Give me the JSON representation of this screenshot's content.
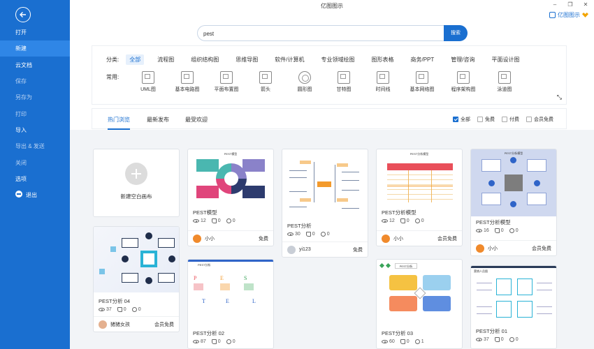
{
  "app": {
    "title": "亿图图示",
    "account_label": "亿图图示"
  },
  "sidebar": {
    "items": [
      {
        "label": "打开"
      },
      {
        "label": "新建"
      },
      {
        "label": "云文档"
      },
      {
        "label": "保存"
      },
      {
        "label": "另存为"
      },
      {
        "label": "打印"
      },
      {
        "label": "导入"
      },
      {
        "label": "导出 & 发送"
      },
      {
        "label": "关闭"
      },
      {
        "label": "选项"
      },
      {
        "label": "退出"
      }
    ]
  },
  "search": {
    "value": "pest",
    "button_label": "搜索"
  },
  "categories": {
    "label": "分类:",
    "items": [
      "全部",
      "流程图",
      "组织结构图",
      "思维导图",
      "软件/计算机",
      "专业领域绘图",
      "图形表格",
      "商务/PPT",
      "管理/咨询",
      "平面设计图"
    ],
    "common_label": "常用:",
    "common_items": [
      "UML图",
      "基本电路图",
      "平面布置图",
      "箭头",
      "圆形图",
      "甘特图",
      "时间线",
      "基本网络图",
      "程序架构图",
      "泳道图"
    ]
  },
  "tabs": {
    "items": [
      "热门浏览",
      "最新发布",
      "最受欢迎"
    ],
    "filters": [
      "全部",
      "免费",
      "付费",
      "会员免费"
    ]
  },
  "new_blank": {
    "label": "新建空白画布"
  },
  "cards": [
    {
      "title": "PEST模型",
      "views": "12",
      "likes": "0",
      "comments": "0",
      "author": "小小",
      "price": "免费",
      "thumb_title": "PEST模型"
    },
    {
      "title": "PEST分析",
      "views": "30",
      "likes": "0",
      "comments": "0",
      "author": "yi123",
      "price": "免费"
    },
    {
      "title": "PEST分析模型",
      "views": "12",
      "likes": "0",
      "comments": "0",
      "author": "小小",
      "price": "会员免费",
      "thumb_title": "PEST分析模型"
    },
    {
      "title": "PEST分析模型",
      "views": "16",
      "likes": "0",
      "comments": "0",
      "author": "小小",
      "price": "会员免费",
      "thumb_title": "PEST分析模型"
    },
    {
      "title": "PEST分析 04",
      "views": "37",
      "likes": "0",
      "comments": "0",
      "author": "猪猪女孩",
      "price": "会员免费"
    },
    {
      "title": "PEST分析 02",
      "views": "87",
      "likes": "0",
      "comments": "0",
      "thumb_title": "PEST分析"
    },
    {
      "title": "PEST分析 03",
      "views": "60",
      "likes": "0",
      "comments": "1",
      "thumb_title": "PEST分析"
    },
    {
      "title": "PEST分析 01",
      "views": "37",
      "likes": "0",
      "comments": "0",
      "thumb_title": "营销人员图"
    }
  ],
  "colors": {
    "sidebar_bg": "#1a6fd0",
    "accent": "#1a6fd0",
    "sidebar_active": "#2f86e6"
  }
}
